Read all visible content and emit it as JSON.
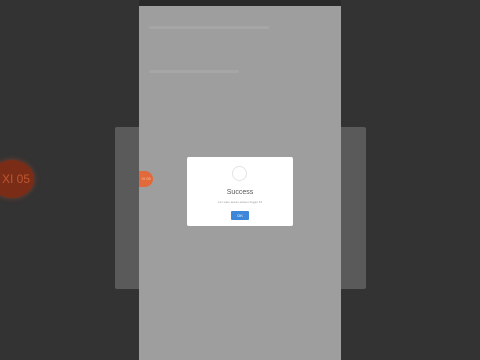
{
  "background": {
    "left_badge_text": "XI 05",
    "page_tab_text": "XI 05"
  },
  "dialog": {
    "title": "Success",
    "message": "Lim viam aceso sareen trigger Fil",
    "ok_label": "OK",
    "accent_color": "#3d86d8"
  }
}
